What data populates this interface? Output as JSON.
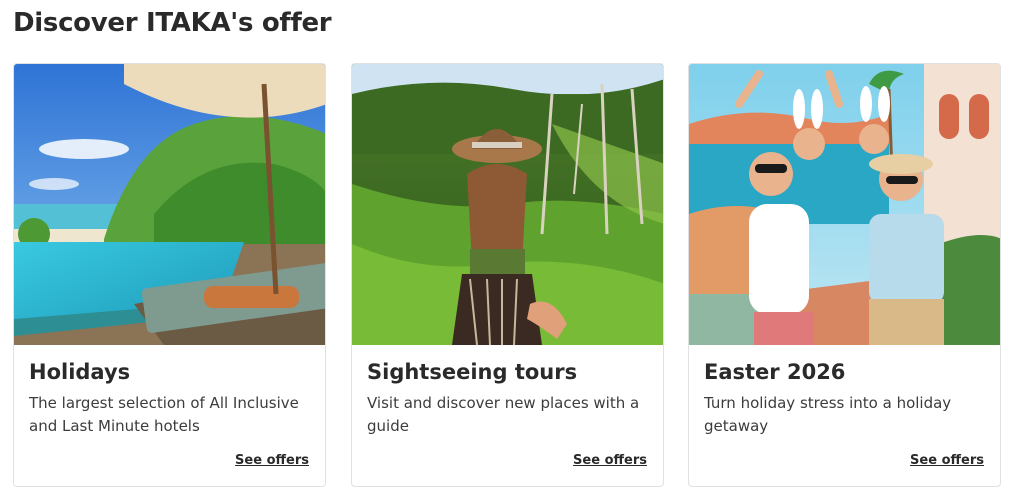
{
  "heading": "Discover ITAKA's offer",
  "cards": [
    {
      "title": "Holidays",
      "description": "The largest selection of All Inclusive and Last Minute hotels",
      "link_label": "See offers"
    },
    {
      "title": "Sightseeing tours",
      "description": "Visit and discover new places with a guide",
      "link_label": "See offers"
    },
    {
      "title": "Easter 2026",
      "description": "Turn holiday stress into a holiday getaway",
      "link_label": "See offers"
    }
  ]
}
